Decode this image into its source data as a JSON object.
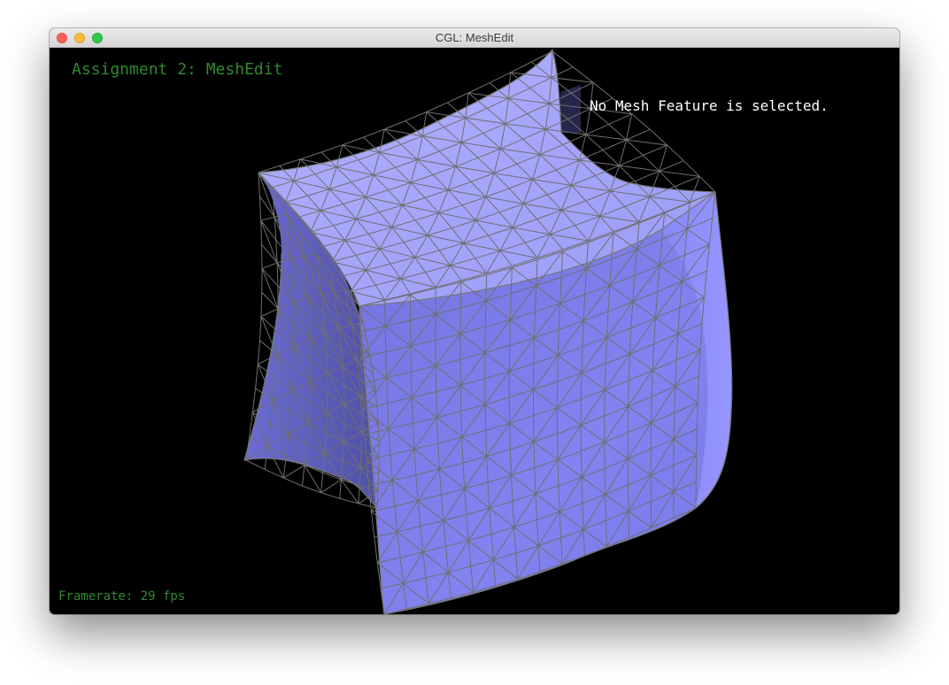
{
  "window": {
    "title": "CGL: MeshEdit"
  },
  "viewport": {
    "app_title": "Assignment 2: MeshEdit",
    "selection_status": "No Mesh Feature is selected.",
    "framerate_text": "Framerate: 29 fps"
  },
  "colors": {
    "background": "#000000",
    "mesh_top": "#a3a4fb",
    "mesh_front": "#7f80ee",
    "mesh_left": "#5a5bb8",
    "wireframe": "#6f6f6f",
    "overlay_green": "#2f8a2f",
    "overlay_white": "#ffffff"
  },
  "icons": {
    "close": "close-circle-icon",
    "minimize": "minimize-circle-icon",
    "maximize": "zoom-circle-icon"
  }
}
